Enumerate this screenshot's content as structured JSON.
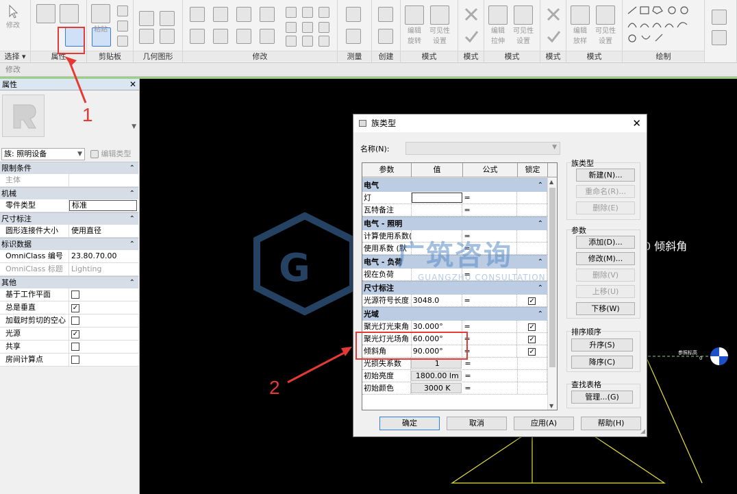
{
  "ribbon": {
    "groups": [
      {
        "label": "选择",
        "dropdown": "▾"
      },
      {
        "label": "属性"
      },
      {
        "label": "剪贴板"
      },
      {
        "label": "几何图形"
      },
      {
        "label": "修改"
      },
      {
        "label": "测量"
      },
      {
        "label": "创建"
      },
      {
        "label": "模式"
      },
      {
        "label": "模式"
      },
      {
        "label": "模式"
      },
      {
        "label": "模式"
      },
      {
        "label": "模式"
      },
      {
        "label": "模式"
      },
      {
        "label": "绘制"
      }
    ],
    "modify_label": "修改",
    "paste_label": "粘贴",
    "edit_rotate": [
      "编辑",
      "旋转"
    ],
    "visibility_settings_1": [
      "可见性",
      "设置"
    ],
    "edit_extrude": [
      "编辑",
      "拉伸"
    ],
    "visibility_settings_2": [
      "可见性",
      "设置"
    ],
    "edit_lofted": [
      "编辑",
      "放样"
    ],
    "visibility_settings_3": [
      "可见性",
      "设置"
    ]
  },
  "context_strip": "修改",
  "properties": {
    "title": "属性",
    "family_selector": "族: 照明设备",
    "edit_type_label": "编辑类型",
    "sections": [
      {
        "name": "限制条件",
        "rows": [
          {
            "name": "主体",
            "value": "",
            "dim": true
          }
        ]
      },
      {
        "name": "机械",
        "rows": [
          {
            "name": "零件类型",
            "value": "标准",
            "boxed": true
          }
        ]
      },
      {
        "name": "尺寸标注",
        "rows": [
          {
            "name": "圆形连接件大小",
            "value": "使用直径"
          }
        ]
      },
      {
        "name": "标识数据",
        "rows": [
          {
            "name": "OmniClass 编号",
            "value": "23.80.70.00"
          },
          {
            "name": "OmniClass 标题",
            "value": "Lighting",
            "dim": true
          }
        ]
      },
      {
        "name": "其他",
        "rows": [
          {
            "name": "基于工作平面",
            "checkbox": false
          },
          {
            "name": "总是垂直",
            "checkbox": true
          },
          {
            "name": "加载时剪切的空心",
            "checkbox": false
          },
          {
            "name": "光源",
            "checkbox": true
          },
          {
            "name": "共享",
            "checkbox": false
          },
          {
            "name": "房间计算点",
            "checkbox": false
          }
        ]
      }
    ]
  },
  "dialog": {
    "title": "族类型",
    "name_label": "名称(N):",
    "name_value": "",
    "columns": [
      "参数",
      "值",
      "公式",
      "锁定"
    ],
    "sections": [
      {
        "name": "电气",
        "rows": [
          {
            "param": "灯",
            "value": "",
            "formula": "=",
            "boxed": true,
            "lock": ""
          },
          {
            "param": "瓦特备注",
            "value": "",
            "formula": "=",
            "lock": ""
          }
        ]
      },
      {
        "name": "电气 - 照明",
        "rows": [
          {
            "param": "计算使用系数(默",
            "value": "",
            "formula": "=",
            "lock": ""
          },
          {
            "param": "使用系数 (默",
            "value": "",
            "formula": "=",
            "lock": ""
          }
        ]
      },
      {
        "name": "电气 - 负荷",
        "rows": [
          {
            "param": "视在负荷",
            "value": "",
            "formula": "=",
            "lock": ""
          }
        ]
      },
      {
        "name": "尺寸标注",
        "rows": [
          {
            "param": "光源符号长度",
            "value": "3048.0",
            "formula": "=",
            "lock": "✓"
          }
        ]
      },
      {
        "name": "光域",
        "rows": [
          {
            "param": "聚光灯光束角",
            "value": "30.000°",
            "formula": "=",
            "lock": "✓"
          },
          {
            "param": "聚光灯光场角",
            "value": "60.000°",
            "formula": "=",
            "lock": "✓"
          },
          {
            "param": "倾斜角",
            "value": "90.000°",
            "formula": "=",
            "lock": "✓"
          },
          {
            "param": "光损失系数",
            "value": "1",
            "formula": "=",
            "btn": true,
            "lock": ""
          },
          {
            "param": "初始亮度",
            "value": "1800.00 lm",
            "formula": "=",
            "btn": true,
            "lock": ""
          },
          {
            "param": "初始颜色",
            "value": "3000 K",
            "formula": "=",
            "btn": true,
            "lock": ""
          }
        ]
      }
    ],
    "family_types_title": "族类型",
    "btn_new": "新建(N)...",
    "btn_rename": "重命名(R)...",
    "btn_delete": "删除(E)",
    "params_title": "参数",
    "btn_add": "添加(D)...",
    "btn_modify": "修改(M)...",
    "btn_delete_param": "删除(V)",
    "btn_move_up": "上移(U)",
    "btn_move_down": "下移(W)",
    "sort_title": "排序顺序",
    "btn_ascending": "升序(S)",
    "btn_descending": "降序(C)",
    "lookup_title": "查找表格",
    "btn_manage": "管理...(G)",
    "btn_ok": "确定",
    "btn_cancel": "取消",
    "btn_apply": "应用(A)",
    "btn_help": "帮助(H)"
  },
  "annotations": {
    "marker_1": "1",
    "marker_2": "2"
  },
  "watermark": {
    "text": "广筑咨询",
    "sub": "GUANGZHU CONSULTATION"
  },
  "canvas": {
    "tilt_label": "0 倾斜角",
    "ref_label": "参照标高",
    "ref_num": "0"
  },
  "colors": {
    "accent": "#2f7fd6",
    "annotation": "#e53935",
    "section": "#bccde3"
  }
}
